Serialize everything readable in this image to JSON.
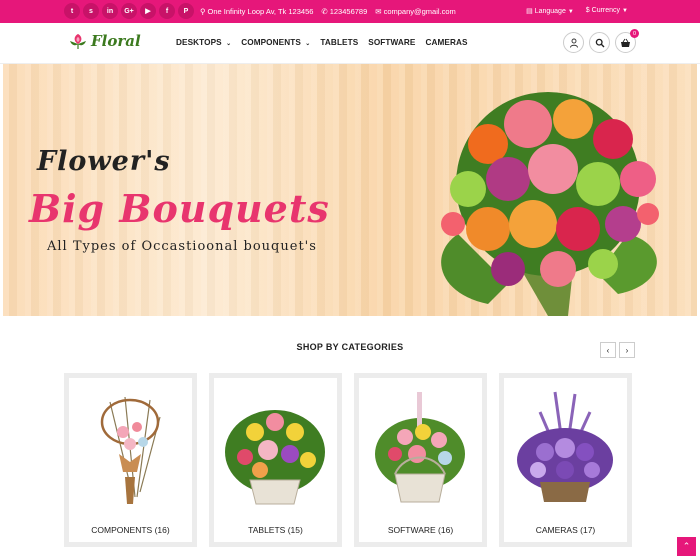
{
  "topbar": {
    "socials": [
      {
        "icon": "twitter-icon",
        "glyph": "t"
      },
      {
        "icon": "skype-icon",
        "glyph": "s"
      },
      {
        "icon": "linkedin-icon",
        "glyph": "in"
      },
      {
        "icon": "google-plus-icon",
        "glyph": "G+"
      },
      {
        "icon": "youtube-icon",
        "glyph": "▶"
      },
      {
        "icon": "facebook-icon",
        "glyph": "f"
      },
      {
        "icon": "pinterest-icon",
        "glyph": "P"
      }
    ],
    "address": "One Infinity Loop Av, Tk 123456",
    "phone": "123456789",
    "email": "company@gmail.com",
    "language": "Language",
    "currency": "Currency"
  },
  "header": {
    "logo_text": "Floral",
    "nav": [
      "DESKTOPS",
      "COMPONENTS",
      "TABLETS",
      "SOFTWARE",
      "CAMERAS"
    ],
    "cart_count": "0"
  },
  "banner": {
    "line1": "Flower's",
    "line2": "Big Bouquets",
    "line3": "All Types of Occastioonal bouquet's"
  },
  "categories": {
    "title": "SHOP BY CATEGORIES",
    "prev": "‹",
    "next": "›",
    "items": [
      {
        "label": "COMPONENTS (16)"
      },
      {
        "label": "TABLETS (15)"
      },
      {
        "label": "SOFTWARE (16)"
      },
      {
        "label": "CAMERAS (17)"
      }
    ]
  },
  "colors": {
    "accent": "#e6177a",
    "logo_green": "#3c7a1f",
    "banner_pink": "#e8356e"
  },
  "back_to_top": "⌃"
}
